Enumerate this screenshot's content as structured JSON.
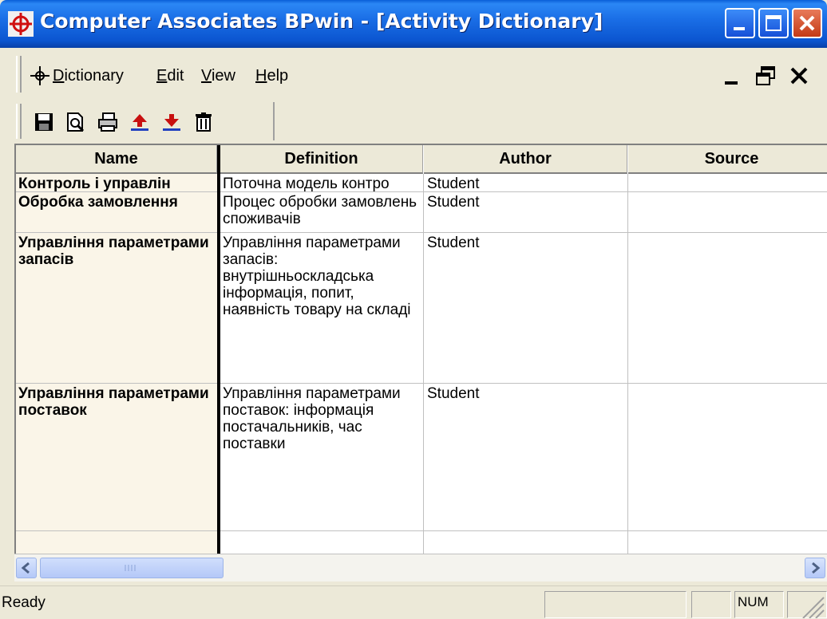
{
  "window": {
    "title": "Computer Associates BPwin - [Activity Dictionary]"
  },
  "menu": {
    "items": [
      {
        "name": "Dictionary",
        "mnemonic": "D"
      },
      {
        "name": "Edit",
        "mnemonic": "E"
      },
      {
        "name": "View",
        "mnemonic": "V"
      },
      {
        "name": "Help",
        "mnemonic": "H"
      }
    ]
  },
  "toolbar": {
    "icons": [
      "save-icon",
      "print-preview-icon",
      "print-icon",
      "import-icon",
      "export-icon",
      "delete-icon"
    ]
  },
  "table": {
    "headers": [
      "Name",
      "Definition",
      "Author",
      "Source"
    ],
    "rows": [
      {
        "name": "Контроль і управлін",
        "definition": "Поточна модель контро",
        "author": "Student",
        "source": ""
      },
      {
        "name": "Обробка замовлення",
        "definition": "Процес обробки замовлень споживачів",
        "author": "Student",
        "source": ""
      },
      {
        "name": "Управління параметрами запасів",
        "definition": "Управління параметрами запасів: внутрішньоскладська інформація, попит, наявність товару на складі",
        "author": "Student",
        "source": ""
      },
      {
        "name": "Управління параметрами поставок",
        "definition": "Управління параметрами поставок: інформація постачальників, час поставки",
        "author": "Student",
        "source": ""
      }
    ]
  },
  "status": {
    "text": "Ready",
    "num": "NUM"
  },
  "colors": {
    "titlebar": "#0B55D0",
    "name_column_bg": "#FAF5E8",
    "window_bg": "#ECE9D8"
  }
}
